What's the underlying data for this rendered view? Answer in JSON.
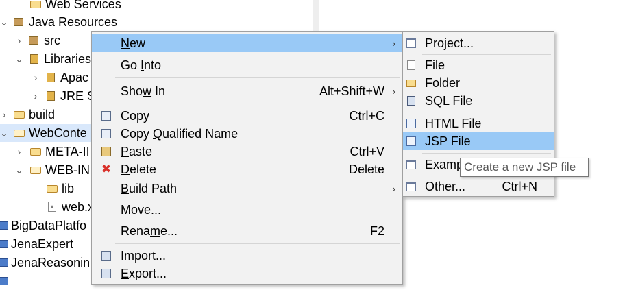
{
  "tree": [
    {
      "label": "Web Services",
      "twisty": "",
      "icon": "folder-icon"
    },
    {
      "label": "Java Resources",
      "twisty": "⌄",
      "icon": "java-resources-icon"
    },
    {
      "label": "src",
      "twisty": "›",
      "icon": "package-folder-icon"
    },
    {
      "label": "Libraries",
      "twisty": "⌄",
      "icon": "library-icon"
    },
    {
      "label": "Apac",
      "twisty": "›",
      "icon": "jar-icon"
    },
    {
      "label": "JRE S",
      "twisty": "›",
      "icon": "jar-icon"
    },
    {
      "label": "build",
      "twisty": "›",
      "icon": "folder-icon"
    },
    {
      "label": "WebConte",
      "twisty": "⌄",
      "icon": "folder-open-icon"
    },
    {
      "label": "META-II",
      "twisty": "›",
      "icon": "folder-icon"
    },
    {
      "label": "WEB-IN",
      "twisty": "⌄",
      "icon": "folder-open-icon"
    },
    {
      "label": "lib",
      "twisty": "",
      "icon": "folder-icon"
    },
    {
      "label": "web.x",
      "twisty": "",
      "icon": "xml-file-icon"
    },
    {
      "label": "BigDataPlatfo",
      "twisty": "",
      "icon": "project-icon"
    },
    {
      "label": "JenaExpert",
      "twisty": "",
      "icon": "project-icon"
    },
    {
      "label": "JenaReasonin",
      "twisty": "",
      "icon": "project-icon"
    }
  ],
  "context_menu": {
    "items": [
      {
        "label": "New",
        "mnemonic_index": 0,
        "shortcut": "",
        "submenu": true
      },
      {
        "label": "Go Into",
        "mnemonic_index": 3,
        "shortcut": "",
        "submenu": false
      },
      {
        "label": "Show In",
        "mnemonic_index": 3,
        "shortcut": "Alt+Shift+W",
        "submenu": true
      },
      {
        "label": "Copy",
        "mnemonic_index": 0,
        "shortcut": "Ctrl+C",
        "submenu": false
      },
      {
        "label": "Copy Qualified Name",
        "mnemonic_index": 5,
        "shortcut": "",
        "submenu": false
      },
      {
        "label": "Paste",
        "mnemonic_index": 0,
        "shortcut": "Ctrl+V",
        "submenu": false
      },
      {
        "label": "Delete",
        "mnemonic_index": 0,
        "shortcut": "Delete",
        "submenu": false
      },
      {
        "label": "Build Path",
        "mnemonic_index": 0,
        "shortcut": "",
        "submenu": true
      },
      {
        "label": "Move...",
        "mnemonic_index": 2,
        "shortcut": "",
        "submenu": false
      },
      {
        "label": "Rename...",
        "mnemonic_index": 4,
        "shortcut": "F2",
        "submenu": false
      },
      {
        "label": "Import...",
        "mnemonic_index": 0,
        "shortcut": "",
        "submenu": false
      },
      {
        "label": "Export...",
        "mnemonic_index": 0,
        "shortcut": "",
        "submenu": false
      }
    ]
  },
  "new_submenu": {
    "items": [
      {
        "label": "Project...",
        "shortcut": ""
      },
      {
        "label": "File",
        "shortcut": ""
      },
      {
        "label": "Folder",
        "shortcut": ""
      },
      {
        "label": "SQL File",
        "shortcut": ""
      },
      {
        "label": "HTML File",
        "shortcut": ""
      },
      {
        "label": "JSP File",
        "shortcut": ""
      },
      {
        "label": "Examp",
        "shortcut": ""
      },
      {
        "label": "Other...",
        "shortcut": "Ctrl+N"
      }
    ]
  },
  "tooltip": "Create a new JSP file",
  "colors": {
    "menu_highlight": "#99c9f6",
    "tree_selection": "#d9e8fb",
    "menu_bg": "#f2f2f2",
    "delete_icon": "#d9322b"
  }
}
